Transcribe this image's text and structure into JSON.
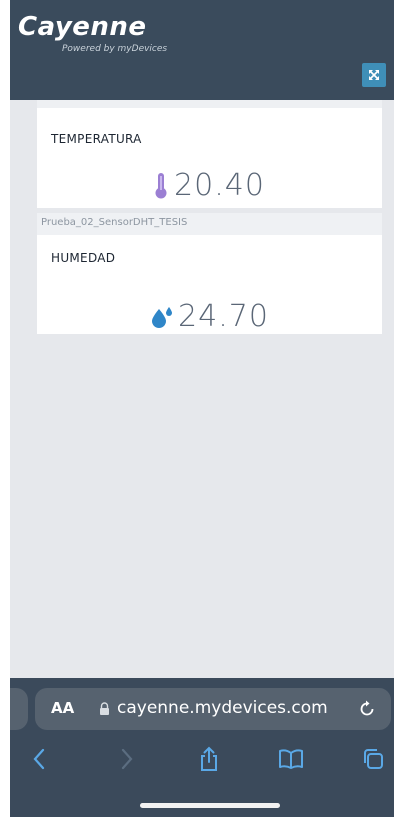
{
  "header": {
    "logo": "Cayenne",
    "logo_sub": "Powered by myDevices",
    "expand_icon": "expand-icon"
  },
  "widgets": [
    {
      "device": "",
      "label": "TEMPERATURA",
      "value": "20.40",
      "icon": "thermometer-icon",
      "icon_color": "#9b7fd3"
    },
    {
      "device": "Prueba_02_SensorDHT_TESIS",
      "label": "HUMEDAD",
      "value": "24.70",
      "icon": "water-drop-icon",
      "icon_color": "#2f86c8"
    }
  ],
  "browser": {
    "text_size_label": "AA",
    "url": "cayenne.mydevices.com",
    "lock_icon": "lock-icon",
    "reload_icon": "reload-icon",
    "nav": [
      "back-icon",
      "forward-icon",
      "share-icon",
      "bookmarks-icon",
      "tabs-icon"
    ]
  },
  "colors": {
    "header_bg": "#3a4b5c",
    "accent": "#3f8fb8",
    "page_bg": "#e6e8ec",
    "browser_bg": "#3b4a5b",
    "nav_active": "#5aa8e6"
  }
}
